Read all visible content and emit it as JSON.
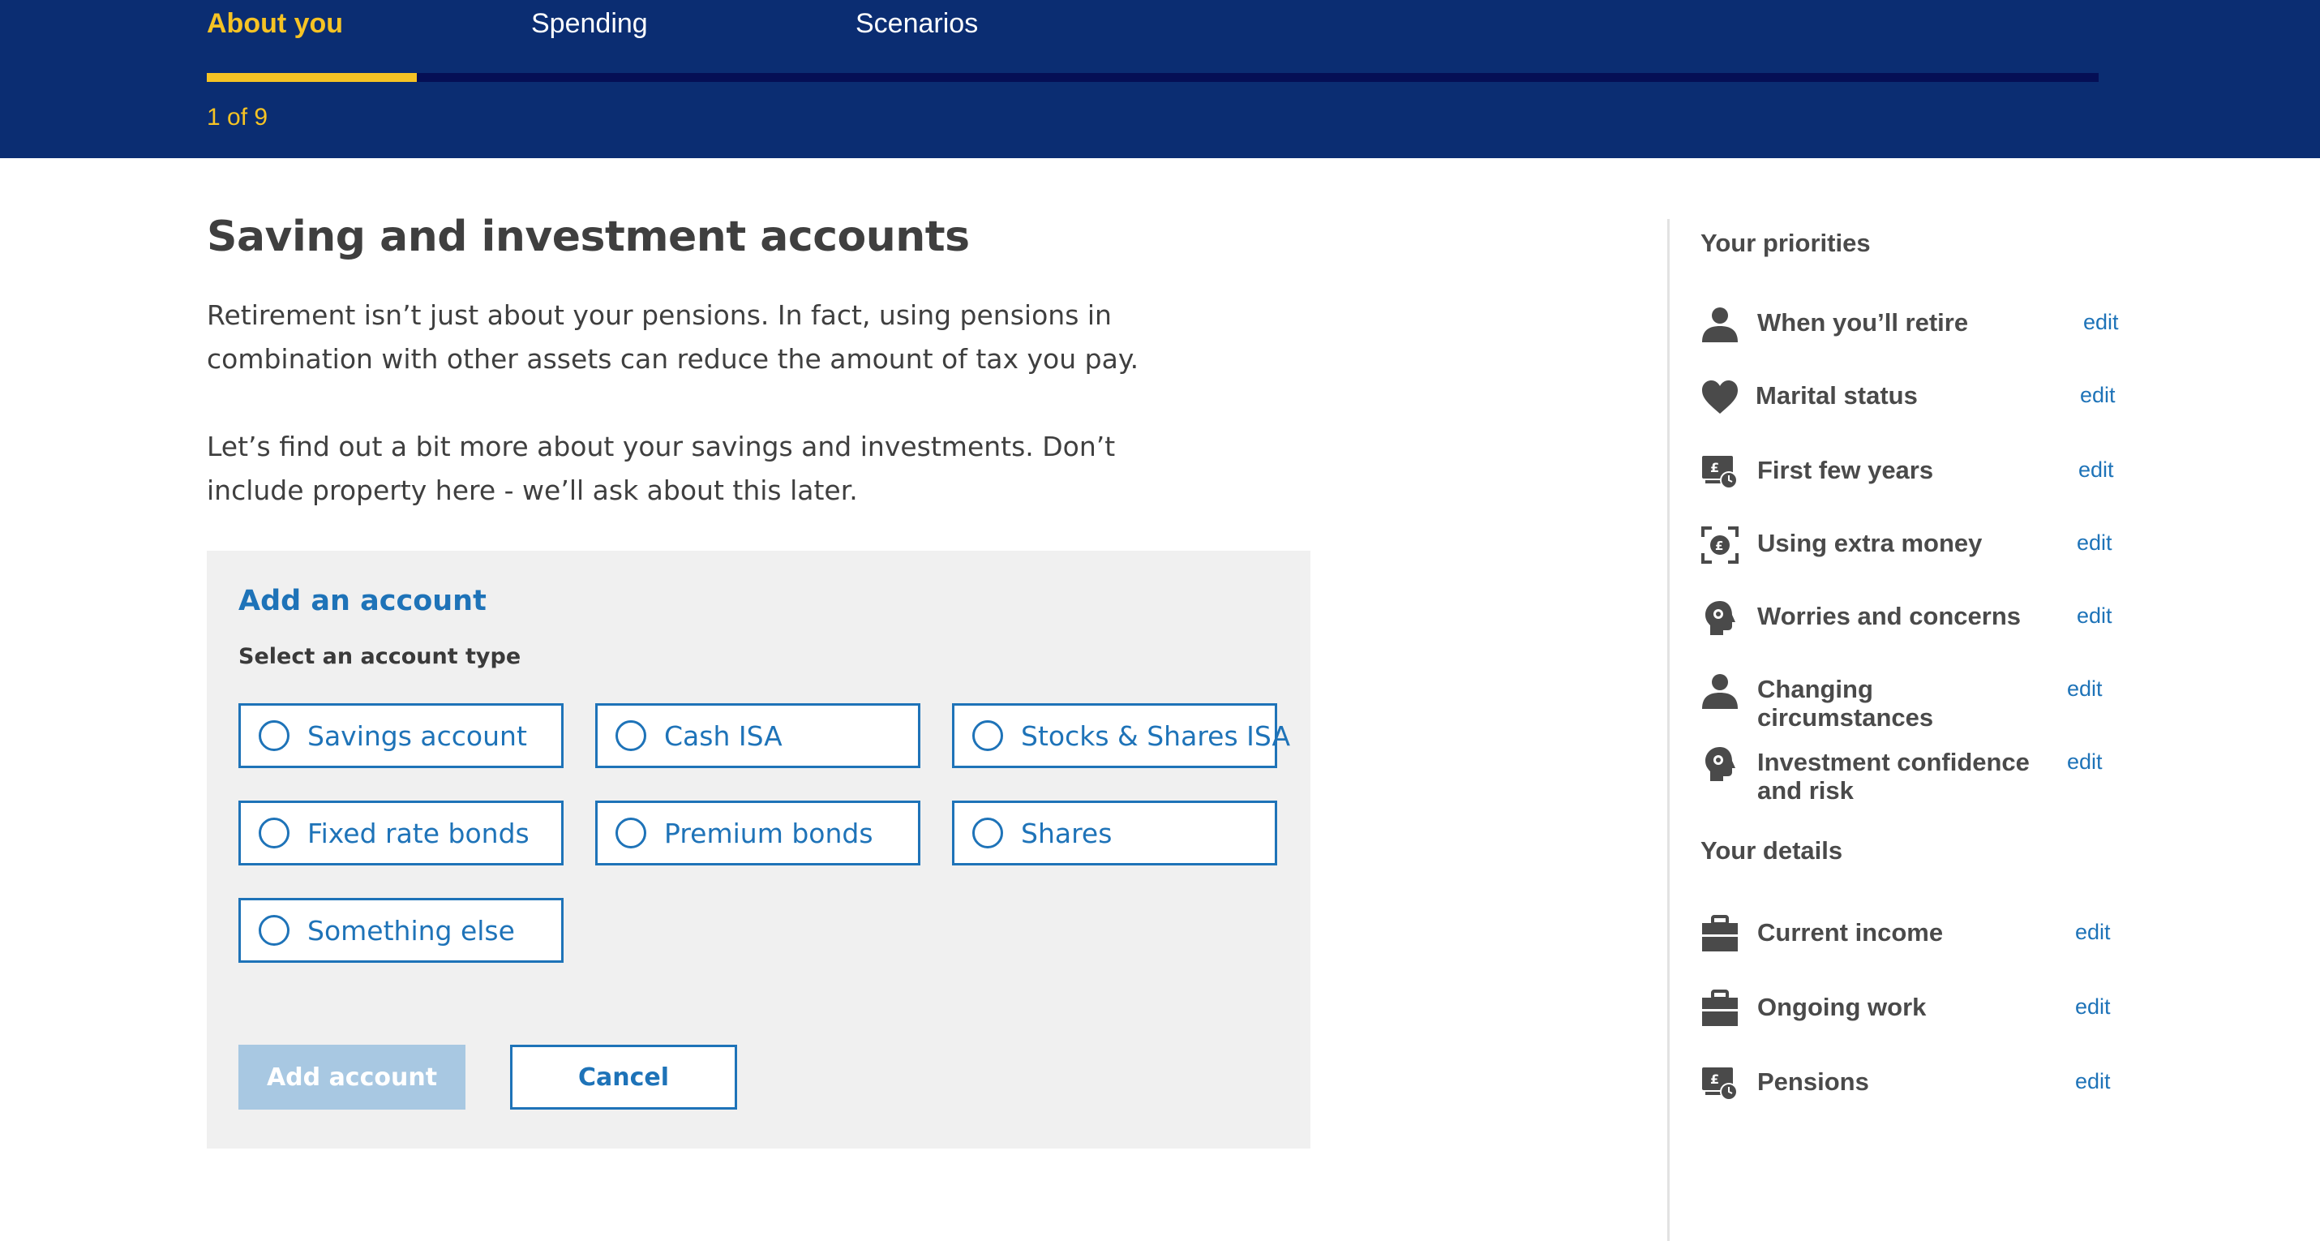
{
  "header": {
    "tabs": [
      {
        "label": "About you",
        "active": true
      },
      {
        "label": "Spending",
        "active": false
      },
      {
        "label": "Scenarios",
        "active": false
      }
    ],
    "progress": {
      "current": 1,
      "total": 9
    },
    "step_counter": "1 of 9"
  },
  "main": {
    "title": "Saving and investment accounts",
    "intro1": "Retirement isn’t just about your pensions. In fact, using pensions in combination with other assets can reduce the amount of tax you pay.",
    "intro2": "Let’s find out a bit more about your savings and investments. Don’t include property here - we’ll ask about this later.",
    "panel": {
      "title": "Add an account",
      "subtitle": "Select an account type",
      "options": [
        "Savings account",
        "Cash ISA",
        "Stocks & Shares ISA",
        "Fixed rate bonds",
        "Premium bonds",
        "Shares",
        "Something else"
      ],
      "add_label": "Add account",
      "cancel_label": "Cancel"
    }
  },
  "sidebar": {
    "priorities_heading": "Your priorities",
    "priorities": [
      {
        "label": "When you’ll retire",
        "icon": "person-icon",
        "edit": "edit"
      },
      {
        "label": "Marital status",
        "icon": "heart-icon",
        "edit": "edit"
      },
      {
        "label": "First few years",
        "icon": "money-clock-icon",
        "edit": "edit"
      },
      {
        "label": "Using extra money",
        "icon": "coin-focus-icon",
        "edit": "edit"
      },
      {
        "label": "Worries and concerns",
        "icon": "head-icon",
        "edit": "edit"
      },
      {
        "label": "Changing circumstances",
        "icon": "person-icon",
        "edit": "edit"
      },
      {
        "label": "Investment confidence and risk",
        "icon": "head-icon",
        "edit": "edit"
      }
    ],
    "details_heading": "Your details",
    "details": [
      {
        "label": "Current income",
        "icon": "briefcase-icon",
        "edit": "edit"
      },
      {
        "label": "Ongoing work",
        "icon": "briefcase-icon",
        "edit": "edit"
      },
      {
        "label": "Pensions",
        "icon": "money-clock-icon",
        "edit": "edit"
      }
    ]
  },
  "colors": {
    "header_bg": "#0b2d72",
    "accent_yellow": "#f6c324",
    "link_blue": "#1e73b8",
    "panel_bg": "#f0f0f0",
    "disabled_button": "#a8c8e2"
  }
}
